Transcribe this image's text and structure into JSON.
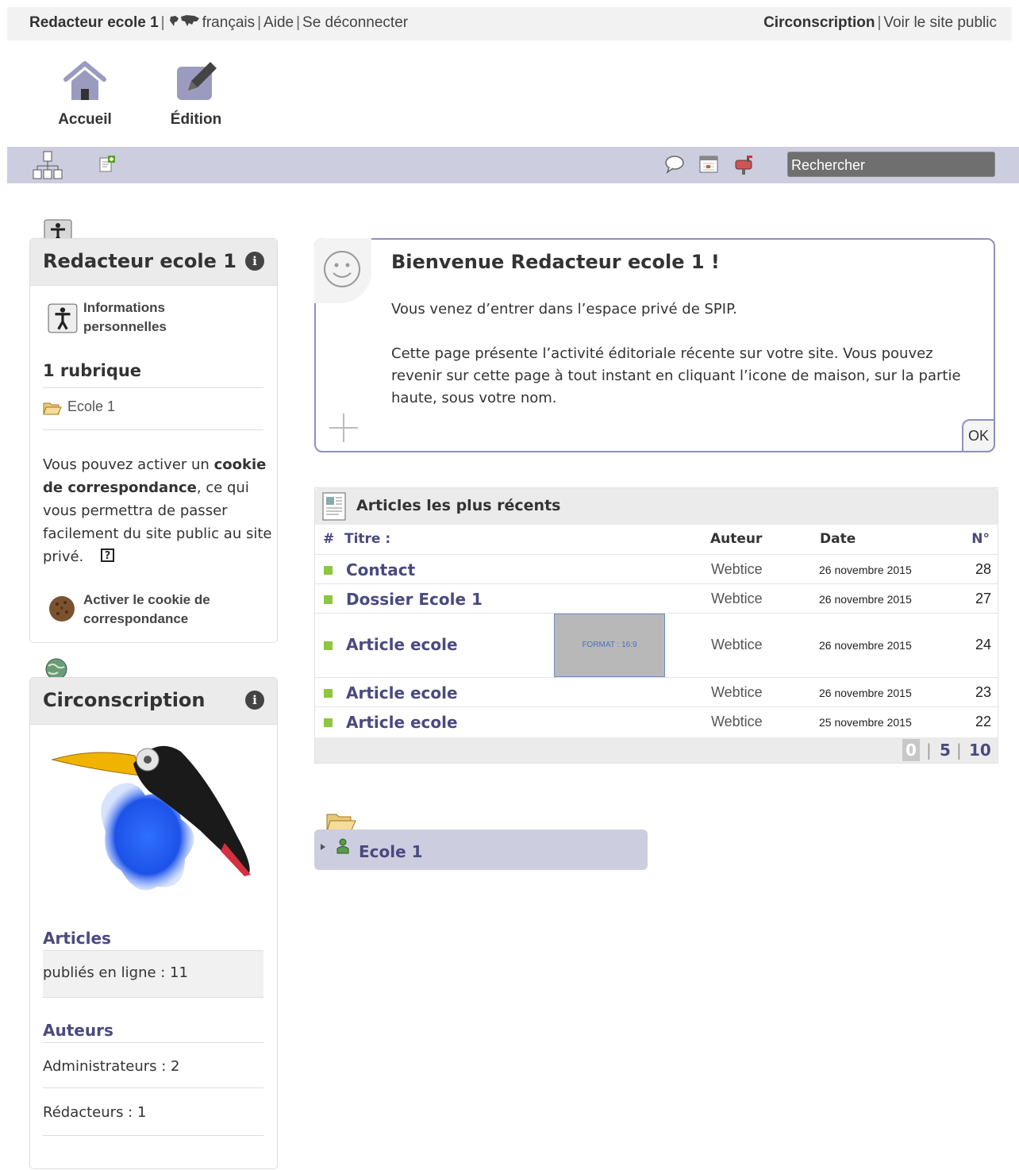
{
  "topbar": {
    "user": "Redacteur ecole 1",
    "lang": "français",
    "help": "Aide",
    "logout": "Se déconnecter",
    "site": "Circonscription",
    "public_site": "Voir le site public"
  },
  "nav": {
    "home": "Accueil",
    "edit": "Édition"
  },
  "search": {
    "placeholder": "Rechercher"
  },
  "user_panel": {
    "title": "Redacteur ecole 1",
    "info_link": "Informations personnelles",
    "rubrique_count": "1 rubrique",
    "rubrique": "Ecole 1",
    "cookie_text_1": "Vous pouvez activer un",
    "cookie_bold": "cookie de correspondance",
    "cookie_text_2": ", ce qui vous permettra de passer facilement du site public au site privé.",
    "cookie_help": "?",
    "cookie_button": "Activer le cookie de correspondance"
  },
  "site_panel": {
    "title": "Circonscription",
    "articles_title": "Articles",
    "articles_published": "publiés en ligne : 11",
    "authors_title": "Auteurs",
    "admins": "Administrateurs : 2",
    "redacteurs": "Rédacteurs : 1"
  },
  "welcome": {
    "title": "Bienvenue Redacteur ecole 1 !",
    "p1": "Vous venez d’entrer dans l’espace privé de SPIP.",
    "p2": "Cette page présente l’activité éditoriale récente sur votre site. Vous pouvez revenir sur cette page à tout instant en cliquant l’icone de maison, sur la partie haute, sous votre nom.",
    "ok": "OK"
  },
  "articles": {
    "title": "Articles les plus récents",
    "columns": {
      "hash": "#",
      "title": "Titre :",
      "author": "Auteur",
      "date": "Date",
      "num": "N°"
    },
    "rows": [
      {
        "title": "Contact",
        "author": "Webtice",
        "date": "26 novembre 2015",
        "num": "28"
      },
      {
        "title": "Dossier Ecole 1",
        "author": "Webtice",
        "date": "26 novembre 2015",
        "num": "27"
      },
      {
        "title": "Article ecole",
        "author": "Webtice",
        "date": "26 novembre 2015",
        "num": "24",
        "thumb": "FORMAT : 16:9"
      },
      {
        "title": "Article ecole",
        "author": "Webtice",
        "date": "26 novembre 2015",
        "num": "23"
      },
      {
        "title": "Article ecole",
        "author": "Webtice",
        "date": "25 novembre 2015",
        "num": "22"
      }
    ],
    "pager": [
      "0",
      "|",
      "5",
      "|",
      "10"
    ]
  },
  "tree": {
    "label": "Ecole 1"
  },
  "colors": {
    "accent": "#4a4a80",
    "toolbar": "#cdcde0",
    "frame": "#8f8fc0",
    "status_published": "#8dc63f"
  }
}
